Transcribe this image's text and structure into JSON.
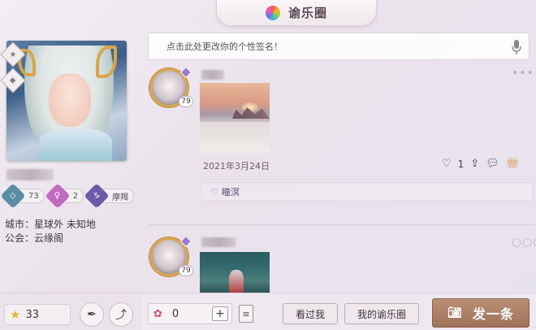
{
  "header": {
    "title": "谕乐圈",
    "icon": "colorful-pinwheel-icon"
  },
  "profile": {
    "stats": [
      {
        "icon": "teal-diamond-icon",
        "value": "73"
      },
      {
        "icon": "pink-diamond-icon",
        "value": "2"
      },
      {
        "icon": "purple-diamond-icon",
        "value": "摩羯"
      }
    ],
    "city_label": "城市：",
    "city_value": "星球外 未知地",
    "guild_label": "公会：",
    "guild_value": "云缘阁",
    "stars": "33"
  },
  "signature": {
    "placeholder": "点击此处更改你的个性签名！"
  },
  "posts": [
    {
      "level": "79",
      "date": "2021年3月24日",
      "likes": "1",
      "liked_by": "瞳溟"
    },
    {
      "level": "79"
    }
  ],
  "footer": {
    "flowers": "0",
    "plus": "+",
    "viewed_label": "看过我",
    "my_circle_label": "我的谕乐圈",
    "post_label": "发一条"
  },
  "colors": {
    "gold": "#d9a752",
    "post_button": "#a97b62",
    "like_name": "#5a4f84"
  }
}
